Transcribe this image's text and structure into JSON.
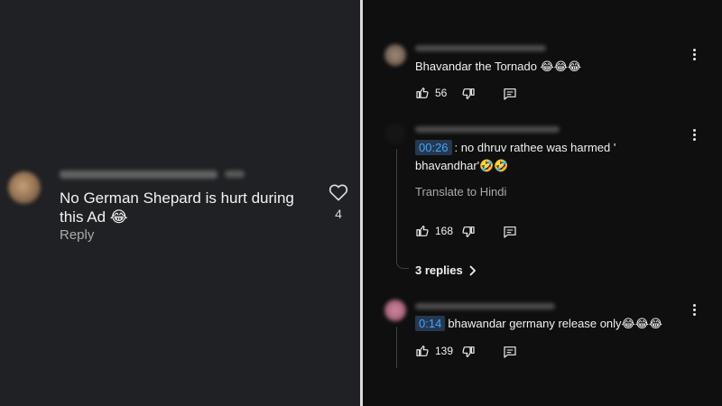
{
  "left": {
    "comment_text": "No German Shepard is hurt during this Ad 😂",
    "reply_label": "Reply",
    "like_count": "4"
  },
  "right": {
    "comments": [
      {
        "text": "Bhavandar the Tornado 😂😂😂",
        "likes": "56"
      },
      {
        "timestamp": "00:26",
        "text": ": no dhruv rathee was harmed ' bhavandhar'🤣🤣",
        "translate_label": "Translate to Hindi",
        "likes": "168",
        "replies_label": "3 replies"
      },
      {
        "timestamp": "0:14",
        "text": "bhawandar germany release only😂😂😂",
        "likes": "139"
      }
    ]
  },
  "icons": {
    "like": "thumbs-up-icon",
    "dislike": "thumbs-down-icon",
    "reply": "comment-reply-icon",
    "more": "more-vertical-icon",
    "heart": "heart-icon",
    "chevron": "chevron-right-icon"
  },
  "colors": {
    "left_bg": "#202124",
    "right_bg": "#0f0f0f",
    "timestamp_bg": "#263850",
    "timestamp_fg": "#3ea6ff"
  }
}
